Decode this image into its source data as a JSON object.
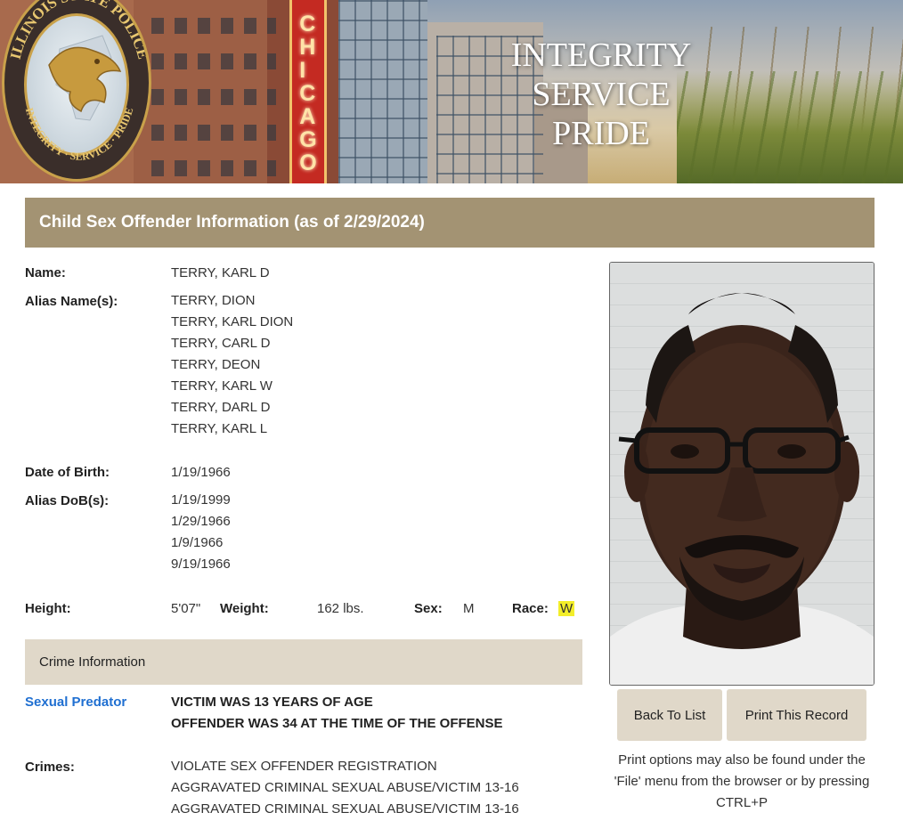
{
  "banner": {
    "seal_text_top": "ILLINOIS STATE POLICE",
    "seal_text_bottom": "INTEGRITY · SERVICE · PRIDE",
    "sign_text": "CHICAGO",
    "motto": [
      "INTEGRITY",
      "SERVICE",
      "PRIDE"
    ]
  },
  "header": {
    "title": "Child Sex Offender Information (as of 2/29/2024)"
  },
  "offender": {
    "name_label": "Name:",
    "name": "TERRY, KARL D",
    "alias_label": "Alias Name(s):",
    "aliases": [
      "TERRY, DION",
      "TERRY, KARL DION",
      "TERRY, CARL D",
      "TERRY, DEON",
      "TERRY, KARL W",
      "TERRY, DARL D",
      "TERRY, KARL L"
    ],
    "dob_label": "Date of Birth:",
    "dob": "1/19/1966",
    "alias_dob_label": "Alias DoB(s):",
    "alias_dobs": [
      "1/19/1999",
      "1/29/1966",
      "1/9/1966",
      "9/19/1966"
    ],
    "height_label": "Height:",
    "height": "5'07\"",
    "weight_label": "Weight:",
    "weight": "162 lbs.",
    "sex_label": "Sex:",
    "sex": "M",
    "race_label": "Race:",
    "race": "W"
  },
  "crime": {
    "section_title": "Crime Information",
    "predator_link": "Sexual Predator",
    "details": [
      "VICTIM WAS 13 YEARS OF AGE",
      "OFFENDER WAS 34 AT THE TIME OF THE OFFENSE"
    ],
    "crimes_label": "Crimes:",
    "crimes": [
      "VIOLATE SEX OFFENDER REGISTRATION",
      "AGGRAVATED CRIMINAL SEXUAL ABUSE/VICTIM 13-16",
      "AGGRAVATED CRIMINAL SEXUAL ABUSE/VICTIM 13-16"
    ]
  },
  "actions": {
    "back_label": "Back To List",
    "print_label": "Print This Record",
    "print_note": "Print options may also be found under the 'File' menu from the browser or by pressing CTRL+P"
  },
  "colors": {
    "title_bar": "#a39373",
    "section_bar": "#e0d8c9",
    "link": "#1f6fd1",
    "highlight": "#f3ee2a"
  }
}
